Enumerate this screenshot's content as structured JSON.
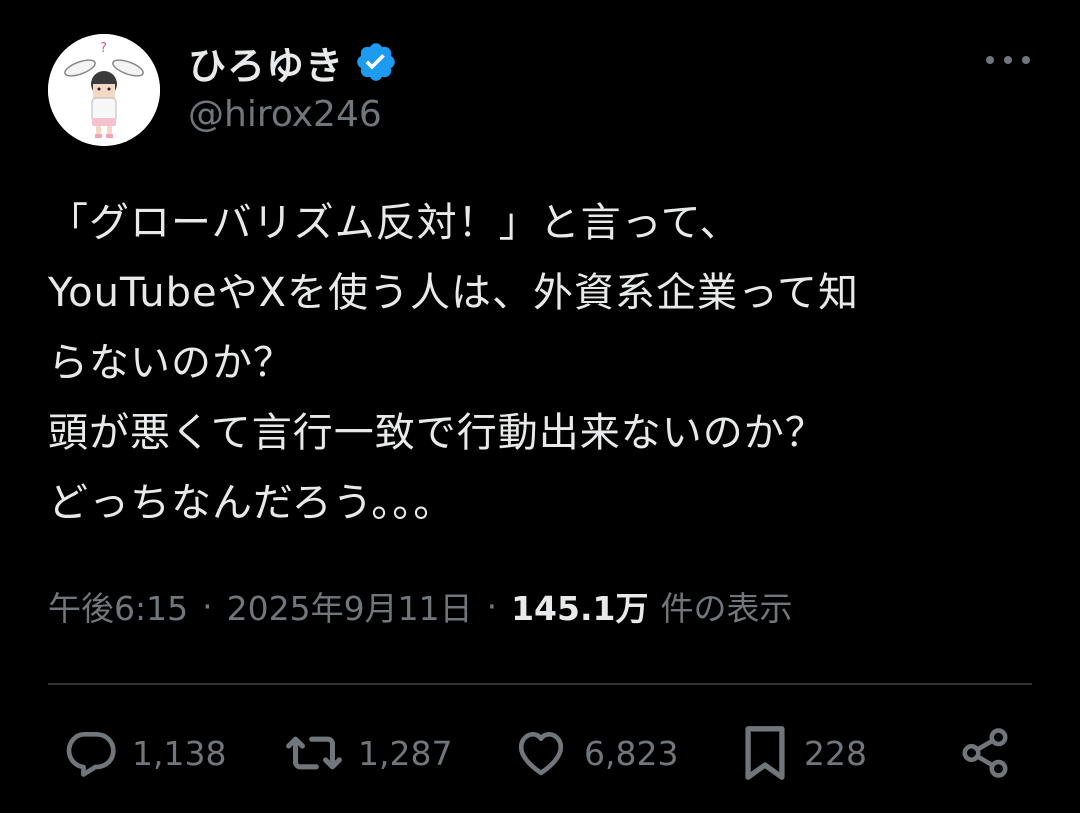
{
  "author": {
    "display_name": "ひろゆき",
    "handle": "@hirox246",
    "verified": true,
    "verified_color": "#1d9bf0",
    "avatar_icon": "avatar-bunny-ears-character"
  },
  "post": {
    "text": "「グローバリズム反対！」と言って、\nYouTubeやXを使う人は、外資系企業って知\nらないのか？\n頭が悪くて言行一致で行動出来ないのか？\nどっちなんだろう。。。"
  },
  "meta": {
    "time": "午後6:15",
    "separator": "·",
    "date": "2025年9月11日",
    "views_count": "145.1万",
    "views_label": "件の表示"
  },
  "actions": {
    "reply": {
      "icon": "reply-icon",
      "count": "1,138"
    },
    "repost": {
      "icon": "repost-icon",
      "count": "1,287"
    },
    "like": {
      "icon": "heart-icon",
      "count": "6,823"
    },
    "bookmark": {
      "icon": "bookmark-icon",
      "count": "228"
    },
    "share": {
      "icon": "share-icon"
    }
  },
  "colors": {
    "background": "#000000",
    "text_primary": "#e7e9ea",
    "text_secondary": "#71767b",
    "divider": "#2f3336"
  }
}
